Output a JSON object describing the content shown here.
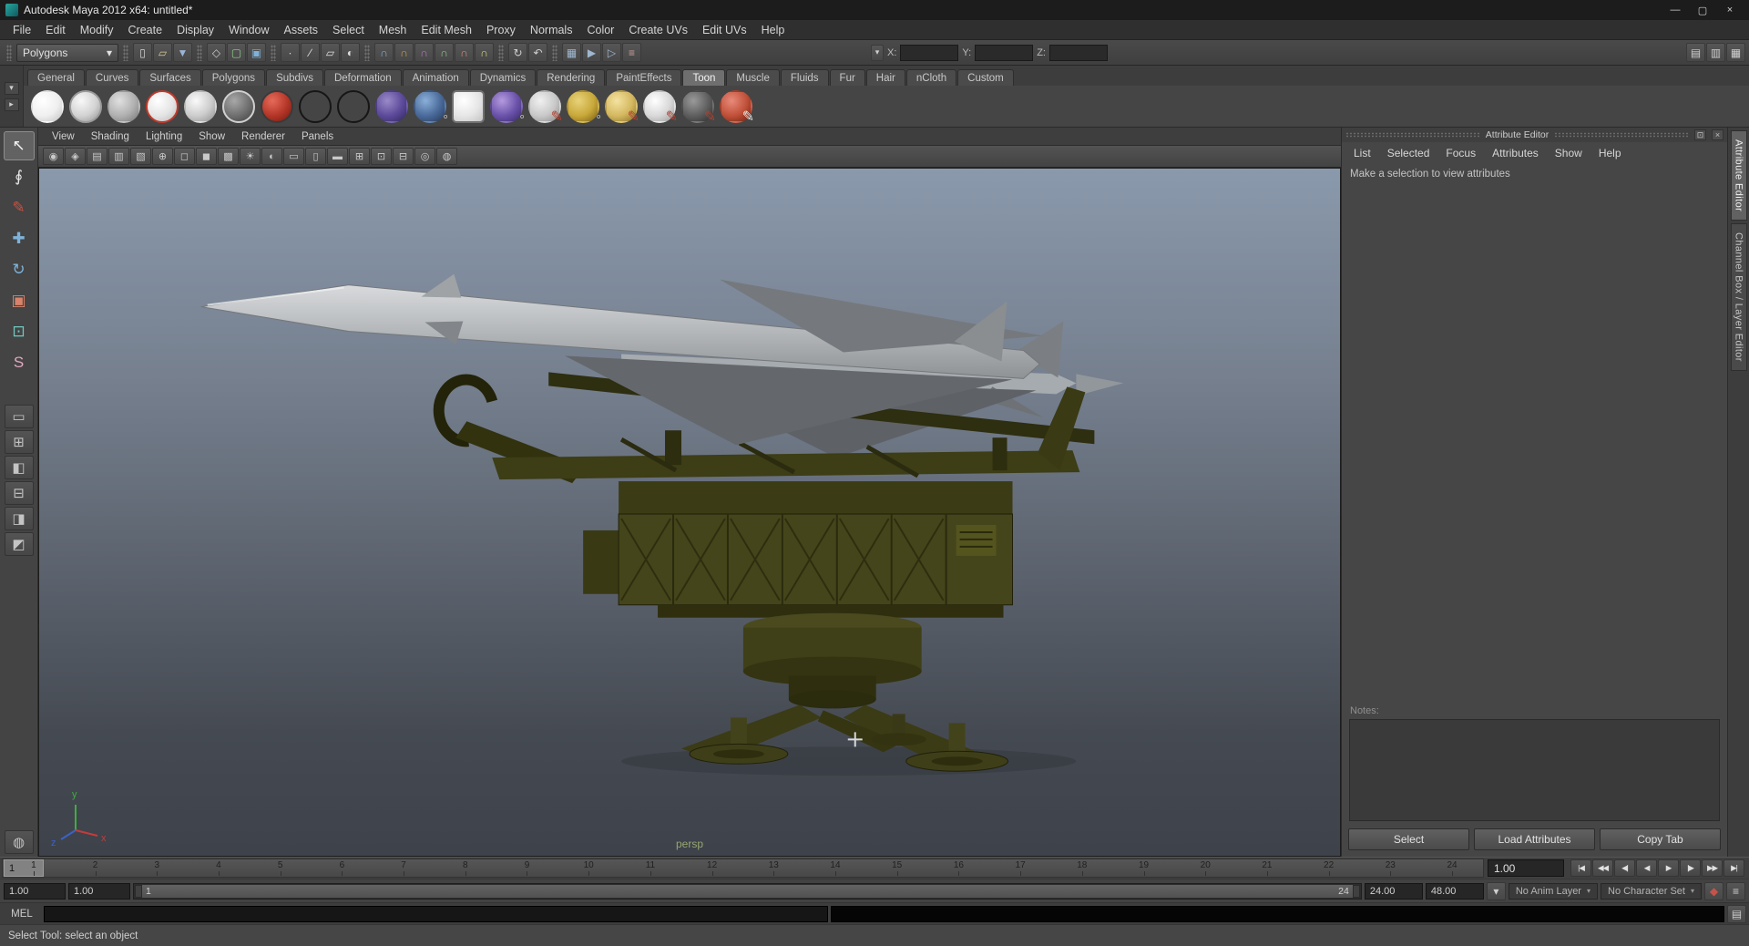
{
  "window": {
    "title": "Autodesk Maya 2012 x64: untitled*",
    "minimize": "—",
    "maximize": "▢",
    "close": "×"
  },
  "menubar": {
    "items": [
      {
        "name": "menu-file",
        "label": "File"
      },
      {
        "name": "menu-edit",
        "label": "Edit"
      },
      {
        "name": "menu-modify",
        "label": "Modify"
      },
      {
        "name": "menu-create",
        "label": "Create"
      },
      {
        "name": "menu-display",
        "label": "Display"
      },
      {
        "name": "menu-window",
        "label": "Window"
      },
      {
        "name": "menu-assets",
        "label": "Assets"
      },
      {
        "name": "menu-select",
        "label": "Select"
      },
      {
        "name": "menu-mesh",
        "label": "Mesh"
      },
      {
        "name": "menu-edit-mesh",
        "label": "Edit Mesh"
      },
      {
        "name": "menu-proxy",
        "label": "Proxy"
      },
      {
        "name": "menu-normals",
        "label": "Normals"
      },
      {
        "name": "menu-color",
        "label": "Color"
      },
      {
        "name": "menu-create-uvs",
        "label": "Create UVs"
      },
      {
        "name": "menu-edit-uvs",
        "label": "Edit UVs"
      },
      {
        "name": "menu-help",
        "label": "Help"
      }
    ]
  },
  "statusline": {
    "menuset": {
      "value": "Polygons",
      "arrow": "▾"
    },
    "file_icons": [
      {
        "name": "new-scene-icon",
        "glyph": "▯",
        "style": "--c:#d8d8d8"
      },
      {
        "name": "open-scene-icon",
        "glyph": "▱",
        "style": "--c:#d8c89a"
      },
      {
        "name": "save-scene-icon",
        "glyph": "▼",
        "style": "--c:#9ab4d8"
      }
    ],
    "selection_icons": [
      {
        "name": "select-by-hierarchy-icon",
        "glyph": "◇",
        "style": "--c:#cfcfcf"
      },
      {
        "name": "select-by-object-icon",
        "glyph": "▢",
        "style": "--c:#8fd08a"
      },
      {
        "name": "select-by-component-icon",
        "glyph": "▣",
        "style": "--c:#7fb2d9"
      }
    ],
    "mask_icons": [
      {
        "name": "select-mask-points-icon",
        "glyph": "∙",
        "style": "--c:#e0e0e0"
      },
      {
        "name": "select-mask-lines-icon",
        "glyph": "∕",
        "style": "--c:#e0e0e0"
      },
      {
        "name": "select-mask-faces-icon",
        "glyph": "▱",
        "style": "--c:#e0e0e0"
      },
      {
        "name": "select-mask-rendering-icon",
        "glyph": "◐",
        "style": "--c:#e0e0e0"
      }
    ],
    "snap_icons": [
      {
        "name": "snap-to-grids-icon",
        "glyph": "∩",
        "style": "--c:#7fb2d9"
      },
      {
        "name": "snap-to-curves-icon",
        "glyph": "∩",
        "style": "--c:#c9a34a"
      },
      {
        "name": "snap-to-points-icon",
        "glyph": "∩",
        "style": "--c:#b878c9"
      },
      {
        "name": "snap-to-projected-center-icon",
        "glyph": "∩",
        "style": "--c:#8fc98f"
      },
      {
        "name": "snap-to-view-planes-icon",
        "glyph": "∩",
        "style": "--c:#d98f7f"
      },
      {
        "name": "make-live-icon",
        "glyph": "∩",
        "style": "--c:#d9d97f"
      }
    ],
    "history_icons": [
      {
        "name": "construction-history-icon",
        "glyph": "↻",
        "style": "--c:#cfcfcf"
      },
      {
        "name": "no-construction-history-icon",
        "glyph": "↶",
        "style": "--c:#cfcfcf"
      }
    ],
    "render_icons": [
      {
        "name": "open-render-view-icon",
        "glyph": "▦",
        "style": "--c:#9fb7cf"
      },
      {
        "name": "render-current-frame-icon",
        "glyph": "▶",
        "style": "--c:#9fb7cf"
      },
      {
        "name": "ipr-render-icon",
        "glyph": "▷",
        "style": "--c:#9fb7cf"
      },
      {
        "name": "render-settings-icon",
        "glyph": "≡",
        "style": "--c:#cf9f9f"
      }
    ],
    "coords": {
      "mode_icon": "▾",
      "x_label": "X:",
      "x_value": "",
      "y_label": "Y:",
      "y_value": "",
      "z_label": "Z:",
      "z_value": ""
    },
    "right_icons": [
      {
        "name": "show-attribute-editor-button",
        "glyph": "▤",
        "style": "--c:#cfcfcf"
      },
      {
        "name": "show-tool-settings-button",
        "glyph": "▥",
        "style": "--c:#cfcfcf"
      },
      {
        "name": "show-channel-box-button",
        "glyph": "▦",
        "style": "--c:#cfcfcf"
      }
    ]
  },
  "shelf": {
    "menu_buttons": [
      {
        "name": "shelf-tabs-toggle-icon",
        "glyph": "▾"
      },
      {
        "name": "shelf-menu-icon",
        "glyph": "▸"
      }
    ],
    "tabs": [
      {
        "name": "shelf-tab-general",
        "label": "General"
      },
      {
        "name": "shelf-tab-curves",
        "label": "Curves"
      },
      {
        "name": "shelf-tab-surfaces",
        "label": "Surfaces"
      },
      {
        "name": "shelf-tab-polygons",
        "label": "Polygons"
      },
      {
        "name": "shelf-tab-subdivs",
        "label": "Subdivs"
      },
      {
        "name": "shelf-tab-deformation",
        "label": "Deformation"
      },
      {
        "name": "shelf-tab-animation",
        "label": "Animation"
      },
      {
        "name": "shelf-tab-dynamics",
        "label": "Dynamics"
      },
      {
        "name": "shelf-tab-rendering",
        "label": "Rendering"
      },
      {
        "name": "shelf-tab-painteffects",
        "label": "PaintEffects"
      },
      {
        "name": "shelf-tab-toon",
        "label": "Toon",
        "selected": true
      },
      {
        "name": "shelf-tab-muscle",
        "label": "Muscle"
      },
      {
        "name": "shelf-tab-fluids",
        "label": "Fluids"
      },
      {
        "name": "shelf-tab-fur",
        "label": "Fur"
      },
      {
        "name": "shelf-tab-hair",
        "label": "Hair"
      },
      {
        "name": "shelf-tab-ncloth",
        "label": "nCloth"
      },
      {
        "name": "shelf-tab-custom",
        "label": "Custom"
      }
    ],
    "icons": [
      {
        "name": "toon-shelf-solid-fill-icon",
        "style": "--hl:#ffffff;--fill:#efefef;--shade:#c2c2c2",
        "glyph": ""
      },
      {
        "name": "toon-shelf-two-tone-fill-icon",
        "style": "--hl:#f8f8f8;--fill:#d2d2d2;--shade:#8e8e8e;--ring:#9a9a9a",
        "glyph": ""
      },
      {
        "name": "toon-shelf-shaded-fill-icon",
        "style": "--hl:#e0e0e0;--fill:#b0b0b0;--shade:#787878",
        "glyph": ""
      },
      {
        "name": "toon-shelf-rim-light-fill-icon",
        "style": "--hl:#ffffff;--fill:#e4e4e4;--shade:#b8b8b8;--ring:#c0392b",
        "glyph": ""
      },
      {
        "name": "toon-shelf-three-tone-fill-icon",
        "style": "--hl:#fafafa;--fill:#cccccc;--shade:#909090",
        "glyph": ""
      },
      {
        "name": "toon-shelf-dark-profile-fill-icon",
        "style": "--hl:#a8a8a8;--fill:#6e6e6e;--shade:#3e3e3e;--ring:#d0d0d0",
        "glyph": ""
      },
      {
        "name": "toon-shelf-circle-highlight-fill-icon",
        "style": "--hl:#e66a5a;--fill:#b33527;--shade:#6e1a10;--ring:#3a3a3a",
        "glyph": ""
      },
      {
        "name": "toon-shelf-profile-line-icon",
        "style": "--hl:rgba(0,0,0,0);--fill:rgba(0,0,0,0);--shade:rgba(0,0,0,0);--ring:#161616",
        "glyph": ""
      },
      {
        "name": "toon-shelf-border-line-icon",
        "style": "--hl:rgba(0,0,0,0);--fill:rgba(0,0,0,0);--shade:rgba(0,0,0,0);--ring:#161616",
        "glyph": ""
      },
      {
        "name": "toon-shelf-crease-line-icon",
        "style": "--hl:#9a8ac8;--fill:#5c4a9a;--shade:#32285e",
        "glyph": ""
      },
      {
        "name": "toon-shelf-assign-outline-icon",
        "style": "--hl:#8ab0d8;--fill:#4a6a9a;--shade:#263a5a;--gc:#dcdcdc",
        "glyph": "◦"
      },
      {
        "name": "toon-shelf-spreadsheet-icon",
        "style": "--hl:#ffffff;--fill:#e6e6e6;--shade:#c4c4c4;--ring:#707070;--r:5px",
        "glyph": ""
      },
      {
        "name": "toon-shelf-remove-outline-icon",
        "style": "--hl:#b49ade;--fill:#6a52aa;--shade:#3a2a6a;--gc:#dcdcdc",
        "glyph": "◦"
      },
      {
        "name": "toon-shelf-paint-line-width-icon",
        "style": "--hl:#f0f0f0;--fill:#c8c8c8;--shade:#8a8a8a;--gc:#b5402f",
        "glyph": "✎"
      },
      {
        "name": "toon-shelf-line-modifier-icon",
        "style": "--hl:#e8d27a;--fill:#c8a83a;--shade:#7a5f14;--gc:#d8d8d8",
        "glyph": "◦"
      },
      {
        "name": "toon-shelf-pfx-toon-gold-icon",
        "style": "--hl:#f4e2a0;--fill:#d4b860;--shade:#8a6f24;--gc:#b5402f",
        "glyph": "✎"
      },
      {
        "name": "toon-shelf-pfx-toon-silver-icon",
        "style": "--hl:#ffffff;--fill:#d8d8d8;--shade:#9a9a9a;--gc:#b5402f",
        "glyph": "✎"
      },
      {
        "name": "toon-shelf-pfx-toon-dark-icon",
        "style": "--hl:#9a9a9a;--fill:#5e5e5e;--shade:#2e2e2e;--gc:#b5402f",
        "glyph": "✎"
      },
      {
        "name": "toon-shelf-pfx-toon-red-icon",
        "style": "--hl:#e88a7a;--fill:#c05038;--shade:#701f10;--gc:#e8e8e8",
        "glyph": "✎"
      }
    ]
  },
  "toolbox": {
    "tools": [
      {
        "name": "select-tool",
        "glyph": "↖",
        "style": "--c:#f2f2f2",
        "selected": true
      },
      {
        "name": "lasso-select-tool",
        "glyph": "∮",
        "style": "--c:#e8e8e8"
      },
      {
        "name": "paint-selection-tool",
        "glyph": "✎",
        "style": "--c:#cf5040"
      },
      {
        "name": "move-tool",
        "glyph": "✚",
        "style": "--c:#7fb2d9"
      },
      {
        "name": "rotate-tool",
        "glyph": "↻",
        "style": "--c:#7fb2d9"
      },
      {
        "name": "scale-tool",
        "glyph": "▣",
        "style": "--c:#d9836a"
      },
      {
        "name": "universal-manipulator-tool",
        "glyph": "⊡",
        "style": "--c:#6fc8c0"
      },
      {
        "name": "soft-modification-tool",
        "glyph": "S",
        "style": "--c:#e2a8c0"
      }
    ],
    "layouts": [
      {
        "name": "layout-single-pane-button",
        "glyph": "▭"
      },
      {
        "name": "layout-four-panes-button",
        "glyph": "⊞"
      },
      {
        "name": "layout-persp-outliner-button",
        "glyph": "◧"
      },
      {
        "name": "layout-two-panes-stacked-button",
        "glyph": "⊟"
      },
      {
        "name": "layout-persp-graph-button",
        "glyph": "◨"
      },
      {
        "name": "layout-hypershade-persp-button",
        "glyph": "◩"
      }
    ],
    "bottom": {
      "glyph": "◍"
    }
  },
  "panel": {
    "menus": [
      {
        "name": "panel-menu-view",
        "label": "View"
      },
      {
        "name": "panel-menu-shading",
        "label": "Shading"
      },
      {
        "name": "panel-menu-lighting",
        "label": "Lighting"
      },
      {
        "name": "panel-menu-show",
        "label": "Show"
      },
      {
        "name": "panel-menu-renderer",
        "label": "Renderer"
      },
      {
        "name": "panel-menu-panels",
        "label": "Panels"
      }
    ],
    "toolbar_icons": [
      {
        "name": "select-camera-icon",
        "glyph": "◉"
      },
      {
        "name": "lock-camera-icon",
        "glyph": "◈"
      },
      {
        "name": "camera-attributes-icon",
        "glyph": "▤"
      },
      {
        "name": "bookmark-view-icon",
        "glyph": "▥"
      },
      {
        "name": "image-plane-icon",
        "glyph": "▧"
      },
      {
        "name": "two-d-pan-zoom-icon",
        "glyph": "⊕"
      },
      {
        "name": "wireframe-mode-icon",
        "glyph": "◻"
      },
      {
        "name": "smooth-shade-mode-icon",
        "glyph": "◼"
      },
      {
        "name": "textured-mode-icon",
        "glyph": "▩"
      },
      {
        "name": "use-all-lights-icon",
        "glyph": "☀"
      },
      {
        "name": "shadows-icon",
        "glyph": "◐"
      },
      {
        "name": "film-gate-icon",
        "glyph": "▭"
      },
      {
        "name": "resolution-gate-icon",
        "glyph": "▯"
      },
      {
        "name": "gate-mask-icon",
        "glyph": "▬"
      },
      {
        "name": "field-chart-icon",
        "glyph": "⊞"
      },
      {
        "name": "safe-action-icon",
        "glyph": "⊡"
      },
      {
        "name": "safe-title-icon",
        "glyph": "⊟"
      },
      {
        "name": "isolate-select-icon",
        "glyph": "◎"
      },
      {
        "name": "x-ray-icon",
        "glyph": "◍"
      }
    ],
    "camera_label": "persp",
    "axis": {
      "x": "x",
      "y": "y",
      "z": "z"
    }
  },
  "attribute_editor": {
    "title": "Attribute Editor",
    "float_icon": "⊡",
    "close_icon": "×",
    "menus": [
      {
        "name": "ae-menu-list",
        "label": "List"
      },
      {
        "name": "ae-menu-selected",
        "label": "Selected"
      },
      {
        "name": "ae-menu-focus",
        "label": "Focus"
      },
      {
        "name": "ae-menu-attributes",
        "label": "Attributes"
      },
      {
        "name": "ae-menu-show",
        "label": "Show"
      },
      {
        "name": "ae-menu-help",
        "label": "Help"
      }
    ],
    "message": "Make a selection to view attributes",
    "notes_label": "Notes:",
    "buttons": [
      {
        "name": "select-button",
        "label": "Select"
      },
      {
        "name": "load-attributes-button",
        "label": "Load Attributes"
      },
      {
        "name": "copy-tab-button",
        "label": "Copy Tab"
      }
    ]
  },
  "side_tabs": [
    {
      "name": "tab-attribute-editor",
      "label": "Attribute Editor",
      "selected": true
    },
    {
      "name": "tab-channel-box-layer-editor",
      "label": "Channel Box / Layer Editor"
    }
  ],
  "timeline": {
    "ticks": [
      "1",
      "2",
      "3",
      "4",
      "5",
      "6",
      "7",
      "8",
      "9",
      "10",
      "11",
      "12",
      "13",
      "14",
      "15",
      "16",
      "17",
      "18",
      "19",
      "20",
      "21",
      "22",
      "23",
      "24"
    ],
    "current_frame": "1",
    "current_time": "1.00",
    "playback": [
      {
        "name": "go-to-playback-start-button",
        "glyph": "|◀"
      },
      {
        "name": "step-back-one-frame-button",
        "glyph": "◀◀"
      },
      {
        "name": "step-back-one-key-button",
        "glyph": "◀|"
      },
      {
        "name": "play-backwards-button",
        "glyph": "◀"
      },
      {
        "name": "play-forwards-button",
        "glyph": "▶"
      },
      {
        "name": "step-forward-one-key-button",
        "glyph": "|▶"
      },
      {
        "name": "step-forward-one-frame-button",
        "glyph": "▶▶"
      },
      {
        "name": "go-to-playback-end-button",
        "glyph": "▶|"
      }
    ]
  },
  "range": {
    "animation_start": "1.00",
    "playback_start": "1.00",
    "bar_start": "1",
    "bar_end": "24",
    "playback_end": "24.00",
    "animation_end": "48.00",
    "anim_layer": "No Anim Layer",
    "character_set": "No Character Set",
    "dropdown_arrow": "▾",
    "auto_key_glyph": "◆",
    "prefs_glyph": "≡"
  },
  "command_line": {
    "label": "MEL",
    "input_value": "",
    "result_value": ""
  },
  "help_line": {
    "text": "Select Tool: select an object"
  },
  "colors": {
    "ui_base": "#444444",
    "titlebar": "#1c1c1c",
    "viewport_top": "#8a99ac",
    "viewport_bottom": "#3e424a",
    "launcher_olive": "#45451b",
    "missile_gray": "#b4b7ba",
    "selected_tab": "#6f6f6f",
    "camera_label": "#96a571"
  }
}
